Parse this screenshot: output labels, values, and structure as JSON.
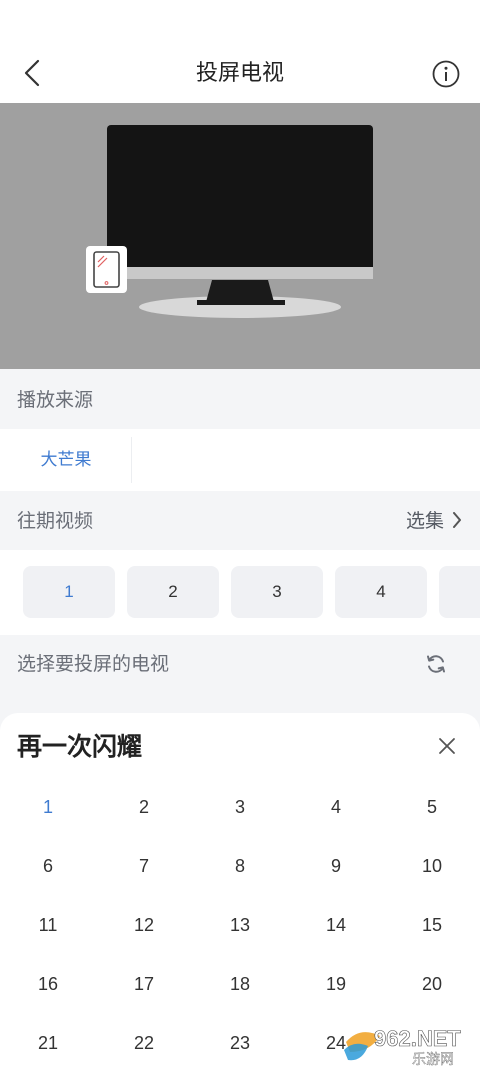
{
  "header": {
    "title": "投屏电视"
  },
  "source": {
    "label": "播放来源",
    "tabs": [
      "大芒果"
    ]
  },
  "episodes": {
    "label": "往期视频",
    "pick_label": "选集",
    "chips": [
      "1",
      "2",
      "3",
      "4",
      ""
    ]
  },
  "devices": {
    "label": "选择要投屏的电视"
  },
  "sheet": {
    "title": "再一次闪耀",
    "numbers": [
      "1",
      "2",
      "3",
      "4",
      "5",
      "6",
      "7",
      "8",
      "9",
      "10",
      "11",
      "12",
      "13",
      "14",
      "15",
      "16",
      "17",
      "18",
      "19",
      "20",
      "21",
      "22",
      "23",
      "24",
      ""
    ]
  },
  "watermark": {
    "brand": "962.NET",
    "sub": "乐游网"
  },
  "colors": {
    "accent": "#3f7bd0",
    "hero_bg": "#a0a0a0",
    "page_bg": "#f4f5f7"
  }
}
